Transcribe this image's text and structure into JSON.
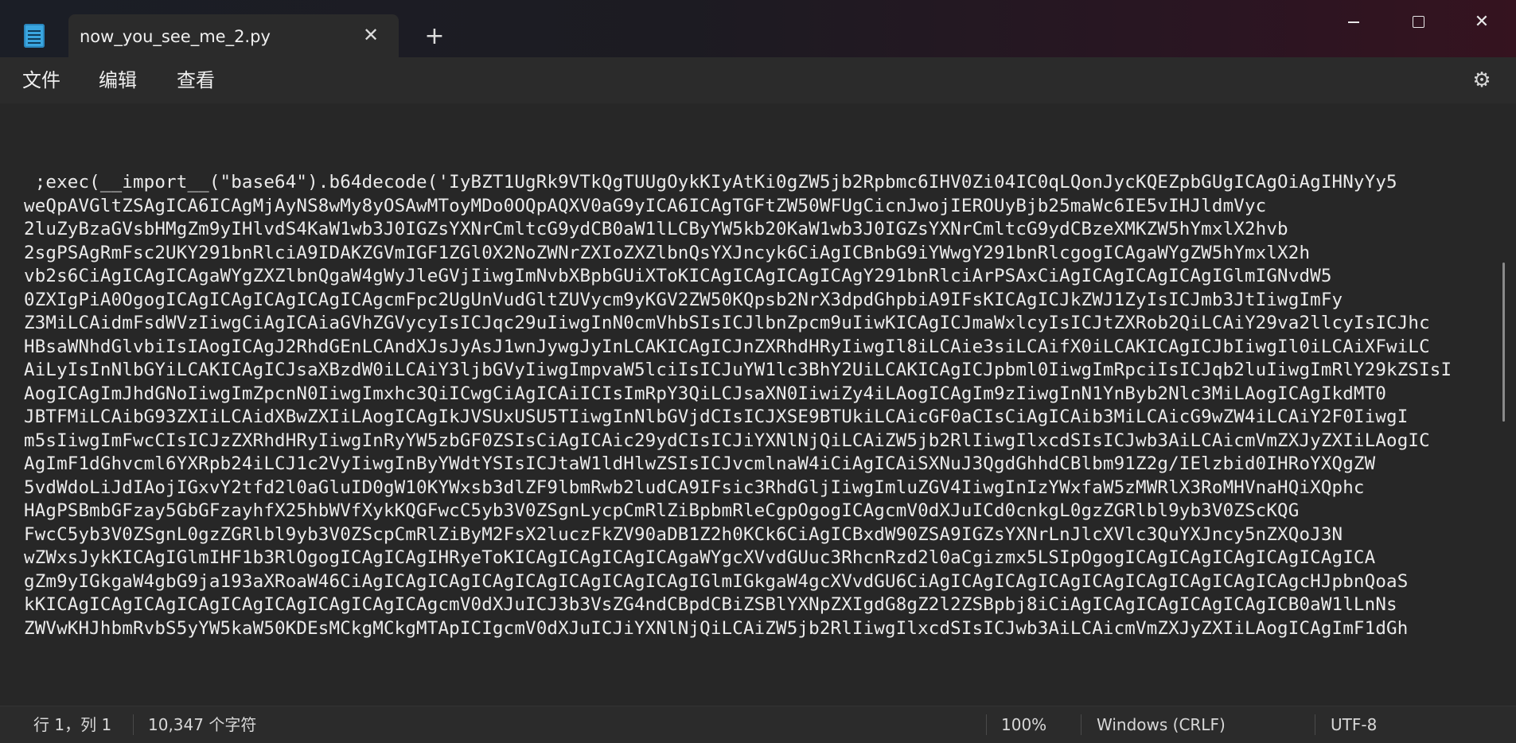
{
  "window": {
    "tab_title": "now_you_see_me_2.py",
    "close_tab_glyph": "✕",
    "new_tab_glyph": "+",
    "close_glyph": "✕"
  },
  "menu": {
    "file": "文件",
    "edit": "编辑",
    "view": "查看",
    "settings_icon": "⚙"
  },
  "editor": {
    "lines": [
      " ;exec(__import__(\"base64\").b64decode('IyBZT1UgRk9VTkQgTUUgOykKIyAtKi0gZW5jb2Rpbmc6IHV0Zi04IC0qLQonJycKQEZpbGUgICAgOiAgIHNyYy5",
      "weQpAVGltZSAgICA6ICAgMjAyNS8wMy8yOSAwMToyMDo0OQpAQXV0aG9yICA6ICAgTGFtZW50WFUgCicnJwojIEROUyBjb25maWc6IE5vIHJldmVyc",
      "2luZyBzaGVsbHMgZm9yIHlvdS4KaW1wb3J0IGZsYXNrCmltcG9ydCB0aW1lLCByYW5kb20KaW1wb3J0IGZsYXNrCmltcG9ydCBzeXMKZW5hYmxlX2hvb",
      "2sgPSAgRmFsc2UKY291bnRlciA9IDAKZGVmIGF1ZGl0X2NoZWNrZXIoZXZlbnQsYXJncyk6CiAgICBnbG9iYWwgY291bnRlcgogICAgaWYgZW5hYmxlX2h",
      "vb2s6CiAgICAgICAgaWYgZXZlbnQgaW4gWyJleGVjIiwgImNvbXBpbGUiXToKICAgICAgICAgICAgY291bnRlciArPSAxCiAgICAgICAgICAgIGlmIGNvdW5",
      "0ZXIgPiA0OgogICAgICAgICAgICAgICAgcmFpc2UgUnVudGltZUVycm9yKGV2ZW50KQpsb2NrX3dpdGhpbiA9IFsKICAgICJkZWJ1ZyIsICJmb3JtIiwgImFy",
      "Z3MiLCAidmFsdWVzIiwgCiAgICAiaGVhZGVycyIsICJqc29uIiwgInN0cmVhbSIsICJlbnZpcm9uIiwKICAgICJmaWxlcyIsICJtZXRob2QiLCAiY29va2llcyIsICJhc",
      "HBsaWNhdGlvbiIsIAogICAgJ2RhdGEnLCAndXJsJyAsJ1wnJywgJyInLCAKICAgICJnZXRhdHRyIiwgIl8iLCAie3siLCAifX0iLCAKICAgICJbIiwgIl0iLCAiXFwiLC",
      "AiLyIsInNlbGYiLCAKICAgICJsaXBzdW0iLCAiY3ljbGVyIiwgImpvaW5lciIsICJuYW1lc3BhY2UiLCAKICAgICJpbml0IiwgImRpciIsICJqb2luIiwgImRlY29kZSIsI",
      "AogICAgImJhdGNoIiwgImZpcnN0IiwgImxhc3QiICwgCiAgICAiICIsImRpY3QiLCJsaXN0IiwiZy4iLAogICAgIm9zIiwgInN1YnByb2Nlc3MiLAogICAgIkdMT0",
      "JBTFMiLCAibG93ZXIiLCAidXBwZXIiLAogICAgIkJVSUxUSU5TIiwgInNlbGVjdCIsICJXSE9BTUkiLCAicGF0aCIsCiAgICAib3MiLCAicG9wZW4iLCAiY2F0IiwgI",
      "m5sIiwgImFwcCIsICJzZXRhdHRyIiwgInRyYW5zbGF0ZSIsCiAgICAic29ydCIsICJiYXNlNjQiLCAiZW5jb2RlIiwgIlxcdSIsICJwb3AiLCAicmVmZXJyZXIiLAogIC",
      "AgImF1dGhvcml6YXRpb24iLCJ1c2VyIiwgInByYWdtYSIsICJtaW1ldHlwZSIsICJvcmlnaW4iCiAgICAiSXNuJ3QgdGhhdCBlbm91Z2g/IElzbid0IHRoYXQgZW",
      "5vdWdoLiJdIAojIGxvY2tfd2l0aGluID0gW10KYWxsb3dlZF9lbmRwb2ludCA9IFsic3RhdGljIiwgImluZGV4IiwgInIzYWxfaW5zMWRlX3RoMHVnaHQiXQphc",
      "HAgPSBmbGFzay5GbGFzayhfX25hbWVfXykKQGFwcC5yb3V0ZSgnLycpCmRlZiBpbmRleCgpOgogICAgcmV0dXJuICd0cnkgL0gzZGRlbl9yb3V0ZScKQG",
      "FwcC5yb3V0ZSgnL0gzZGRlbl9yb3V0ZScpCmRlZiByM2FsX2luczFkZV90aDB1Z2h0KCk6CiAgICBxdW90ZSA9IGZsYXNrLnJlcXVlc3QuYXJncy5nZXQoJ3N",
      "wZWxsJykKICAgIGlmIHF1b3RlOgogICAgICAgIHRyeToKICAgICAgICAgICAgaWYgcXVvdGUuc3RhcnRzd2l0aCgizmx5LSIpOgogICAgICAgICAgICAgICAgICA",
      "gZm9yIGkgaW4gbG9ja193aXRoaW46CiAgICAgICAgICAgICAgICAgICAgICAgIGlmIGkgaW4gcXVvdGU6CiAgICAgICAgICAgICAgICAgICAgICAgICAgcHJpbnQoaS",
      "kKICAgICAgICAgICAgICAgICAgICAgICAgICAgcmV0dXJuICJ3b3VsZG4ndCBpdCBiZSBlYXNpZXIgdG8gZ2l2ZSBpbj8iCiAgICAgICAgICAgICAgICB0aW1lLnNs",
      "ZWVwKHJhbmRvbS5yYW5kaW50KDEsMCkgMCkgMTApICIgcmV0dXJuICJiYXNlNjQiLCAiZW5jb2RlIiwgIlxcdSIsICJwb3AiLCAicmVmZXJyZXIiLAogICAgImF1dGh"
    ]
  },
  "status": {
    "position": "行 1，列 1",
    "char_count": "10,347 个字符",
    "zoom": "100%",
    "line_ending": "Windows (CRLF)",
    "encoding": "UTF-8"
  }
}
